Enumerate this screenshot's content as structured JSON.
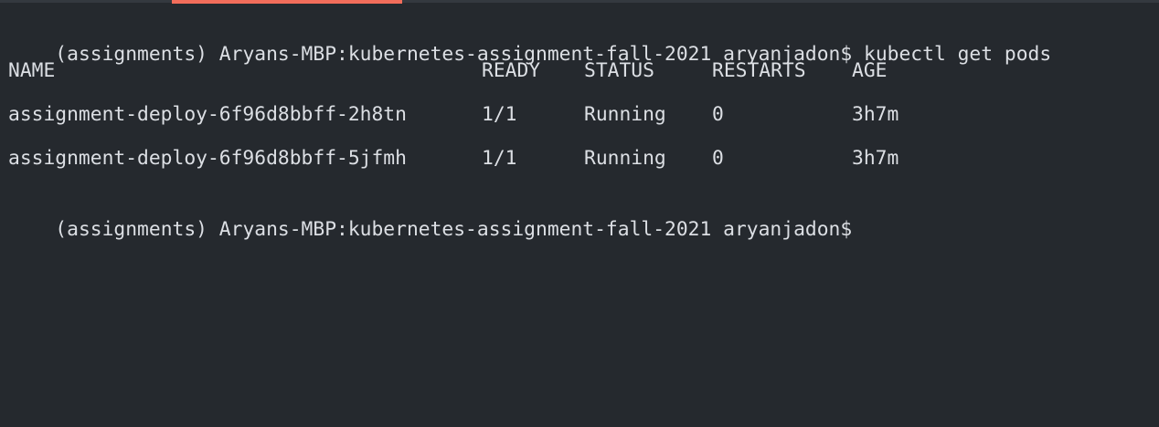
{
  "colors": {
    "background": "#25292e",
    "foreground": "#dcdfe4",
    "tab_accent": "#f26d5b"
  },
  "command_line": {
    "prompt": "(assignments) Aryans-MBP:kubernetes-assignment-fall-2021 aryanjadon$",
    "command": "kubectl get pods"
  },
  "table": {
    "headers": [
      "NAME",
      "READY",
      "STATUS",
      "RESTARTS",
      "AGE"
    ],
    "rows": [
      [
        "assignment-deploy-6f96d8bbff-2h8tn",
        "1/1",
        "Running",
        "0",
        "3h7m"
      ],
      [
        "assignment-deploy-6f96d8bbff-5jfmh",
        "1/1",
        "Running",
        "0",
        "3h7m"
      ]
    ]
  },
  "final_prompt": "(assignments) Aryans-MBP:kubernetes-assignment-fall-2021 aryanjadon$"
}
